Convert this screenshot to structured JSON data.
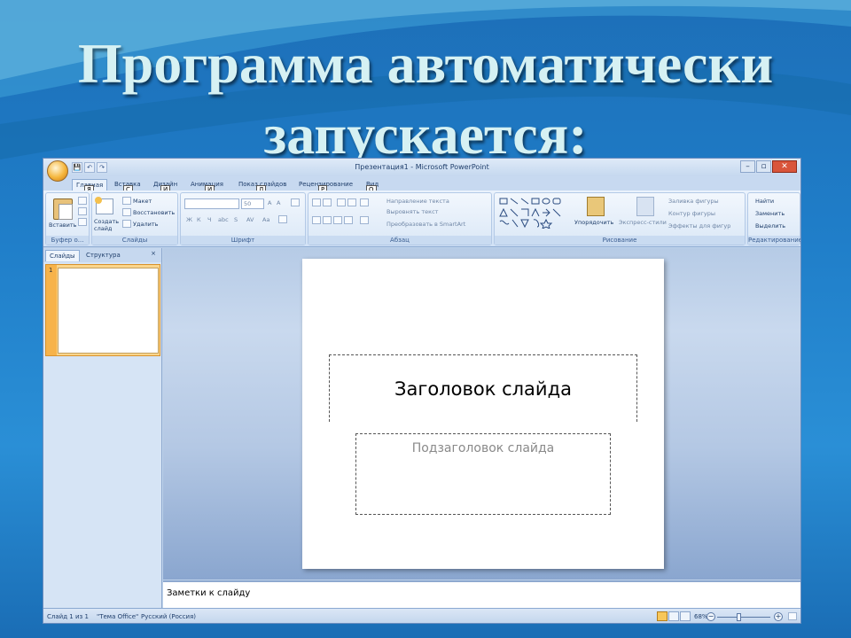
{
  "title": {
    "line1": "Программа автоматически",
    "line2": "запускается:"
  },
  "window": {
    "title": "Презентация1 - Microsoft PowerPoint",
    "controls": {
      "minimize": "–",
      "maximize": "▫",
      "close": "✕"
    },
    "qat": [
      "💾",
      "↶",
      "↷"
    ]
  },
  "tabs": [
    {
      "label": "Главная",
      "keytip": "Я"
    },
    {
      "label": "Вставка",
      "keytip": "С"
    },
    {
      "label": "Дизайн",
      "keytip": "Й"
    },
    {
      "label": "Анимация",
      "keytip": "И"
    },
    {
      "label": "Показ слайдов",
      "keytip": "Д"
    },
    {
      "label": "Рецензирование",
      "keytip": "Р"
    },
    {
      "label": "Вид",
      "keytip": "О"
    }
  ],
  "ribbon": {
    "clipboard": {
      "label": "Буфер о...",
      "paste": "Вставить"
    },
    "slides": {
      "label": "Слайды",
      "new_slide": "Создать слайд",
      "layout": "Макет",
      "reset": "Восстановить",
      "delete": "Удалить"
    },
    "font": {
      "label": "Шрифт",
      "font_size": "50",
      "bold": "Ж",
      "italic": "К",
      "underline": "Ч",
      "strike": "abc",
      "shadow": "S",
      "spacing": "AV",
      "case": "Aa",
      "grow": "A",
      "shrink": "A"
    },
    "paragraph": {
      "label": "Абзац",
      "direction": "Направление текста",
      "align": "Выровнять текст",
      "smartart": "Преобразовать в SmartArt"
    },
    "drawing": {
      "label": "Рисование",
      "arrange": "Упорядочить",
      "quick_styles": "Экспресс-стили",
      "fill": "Заливка фигуры",
      "outline": "Контур фигуры",
      "effects": "Эффекты для фигур"
    },
    "editing": {
      "label": "Редактирование",
      "find": "Найти",
      "replace": "Заменить",
      "select": "Выделить"
    }
  },
  "pane": {
    "tab_slides": "Слайды",
    "tab_outline": "Структура",
    "close": "×",
    "thumb_number": "1"
  },
  "slide": {
    "title_placeholder": "Заголовок слайда",
    "subtitle_placeholder": "Подзаголовок слайда"
  },
  "notes": {
    "placeholder": "Заметки к слайду"
  },
  "status": {
    "slide": "Слайд 1 из 1",
    "theme": "\"Тема Office\"",
    "language": "Русский (Россия)",
    "zoom": "68%",
    "zoom_out": "−",
    "zoom_in": "+"
  }
}
